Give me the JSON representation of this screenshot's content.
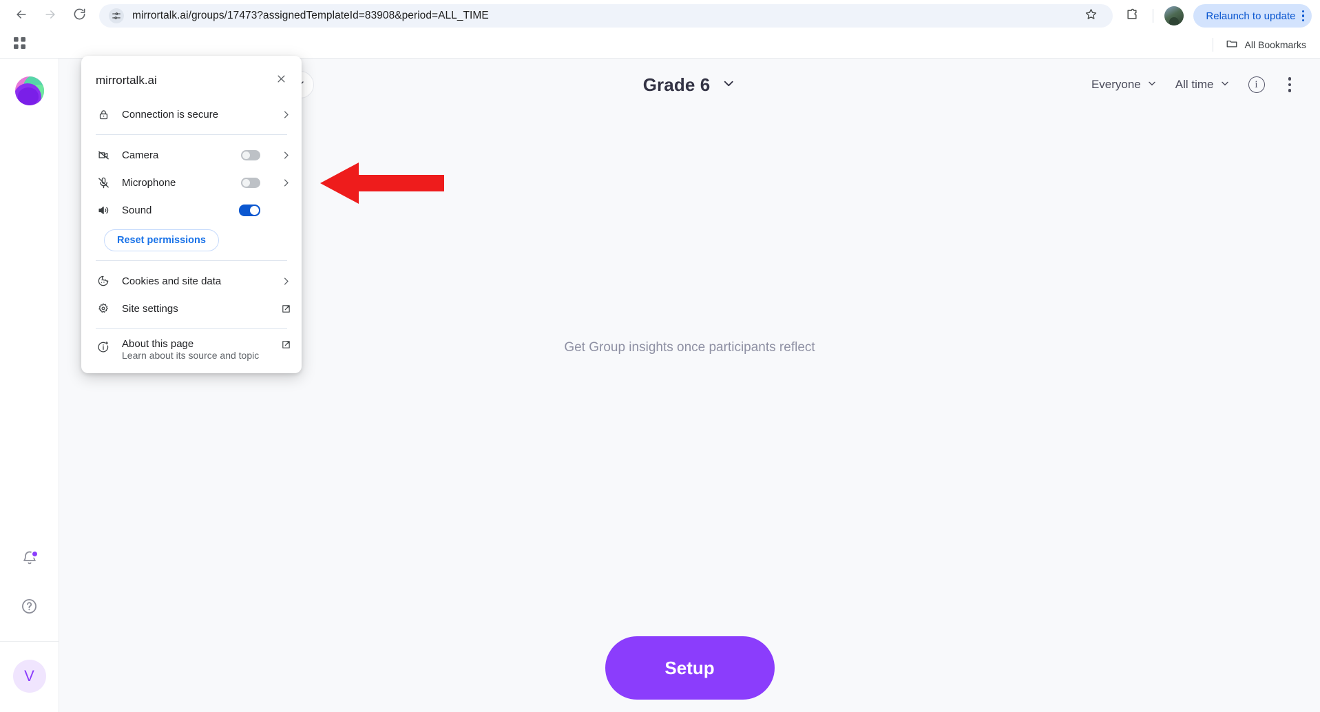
{
  "browser": {
    "back_icon": "back-arrow-icon",
    "forward_icon": "forward-arrow-icon",
    "reload_icon": "reload-icon",
    "site_info_icon": "site-settings-tune-icon",
    "url": "mirrortalk.ai/groups/17473?assignedTemplateId=83908&period=ALL_TIME",
    "bookmark_icon": "star-icon",
    "extensions_icon": "puzzle-piece-icon",
    "profile_icon": "profile-avatar-icon",
    "relaunch_label": "Relaunch to update",
    "chrome_menu_icon": "three-dot-menu-icon",
    "bookmarks": {
      "apps_icon": "apps-grid-icon",
      "folder_icon": "folder-icon",
      "all_bookmarks_label": "All Bookmarks"
    }
  },
  "site_bubble": {
    "title": "mirrortalk.ai",
    "close_icon": "close-icon",
    "connection": {
      "icon": "lock-icon",
      "label": "Connection is secure",
      "chevron": "chevron-right-icon"
    },
    "permissions": [
      {
        "icon": "camera-off-icon",
        "label": "Camera",
        "state": "off",
        "chevron": "chevron-right-icon"
      },
      {
        "icon": "microphone-off-icon",
        "label": "Microphone",
        "state": "off",
        "chevron": "chevron-right-icon"
      },
      {
        "icon": "sound-on-icon",
        "label": "Sound",
        "state": "on",
        "chevron": ""
      }
    ],
    "reset_label": "Reset permissions",
    "cookies": {
      "icon": "cookie-icon",
      "label": "Cookies and site data",
      "chevron": "chevron-right-icon"
    },
    "site_settings": {
      "icon": "gear-icon",
      "label": "Site settings",
      "external_icon": "external-link-icon"
    },
    "about": {
      "icon": "info-sparkle-icon",
      "title": "About this page",
      "subtitle": "Learn about its source and topic",
      "external_icon": "external-link-icon"
    }
  },
  "annotation": {
    "arrow_color": "#ee1c1c",
    "arrow_name": "red-pointer-arrow"
  },
  "sidebar": {
    "logo_icon": "mirrortalk-logo-sphere",
    "notifications_icon": "bell-icon",
    "notifications_badge_color": "#8b3dfc",
    "help_icon": "help-circle-icon",
    "avatar_initial": "V"
  },
  "header": {
    "collapse_icon": "chevron-down-icon",
    "title": "Grade 6",
    "title_chevron": "chevron-down-icon",
    "audience_filter": "Everyone",
    "audience_chevron": "chevron-down-icon",
    "period_filter": "All time",
    "period_chevron": "chevron-down-icon",
    "info_icon": "info-circle-icon",
    "more_icon": "three-dot-menu-icon"
  },
  "main": {
    "empty_message": "Get Group insights once participants reflect",
    "setup_label": "Setup",
    "setup_color": "#8b3dfc"
  }
}
